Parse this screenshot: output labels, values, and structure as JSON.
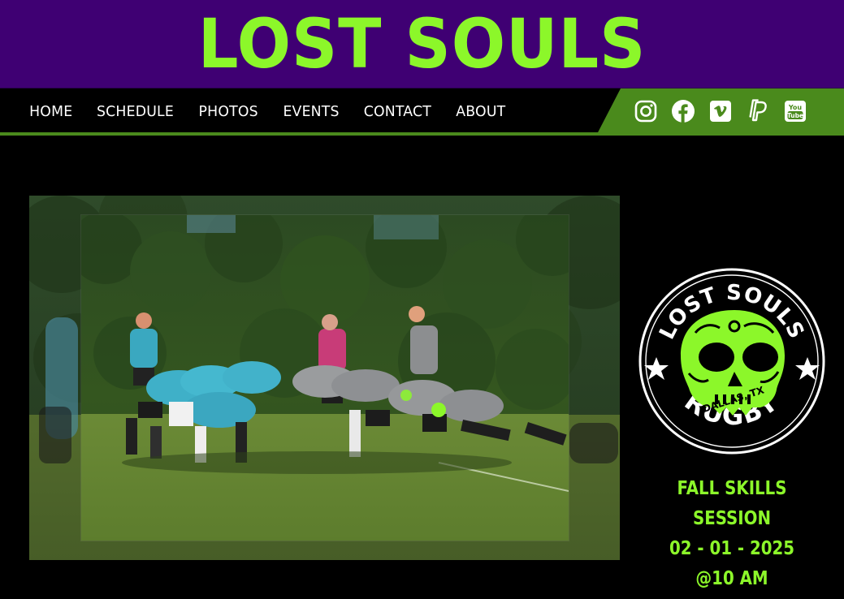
{
  "header": {
    "brand": "LOST SOULS"
  },
  "nav": {
    "items": [
      {
        "label": "HOME"
      },
      {
        "label": "SCHEDULE"
      },
      {
        "label": "PHOTOS"
      },
      {
        "label": "EVENTS"
      },
      {
        "label": "CONTACT"
      },
      {
        "label": "ABOUT"
      }
    ]
  },
  "social": [
    {
      "icon": "instagram-icon"
    },
    {
      "icon": "facebook-icon"
    },
    {
      "icon": "vimeo-icon"
    },
    {
      "icon": "paypal-icon"
    },
    {
      "icon": "youtube-icon",
      "text": "You Tube"
    }
  ],
  "hero": {
    "image": "rugby scrum photo"
  },
  "logo": {
    "top_text": "LOST SOULS",
    "middle_text": "DALLAS, TX",
    "bottom_text": "RUGBY"
  },
  "event": {
    "title": "FALL SKILLS SESSION",
    "date": "02 - 01 - 2025",
    "time": "@10 AM"
  },
  "colors": {
    "brand_green": "#8cf72a",
    "header_purple": "#3f0073",
    "nav_green": "#4a8a1c",
    "background": "#000000"
  }
}
